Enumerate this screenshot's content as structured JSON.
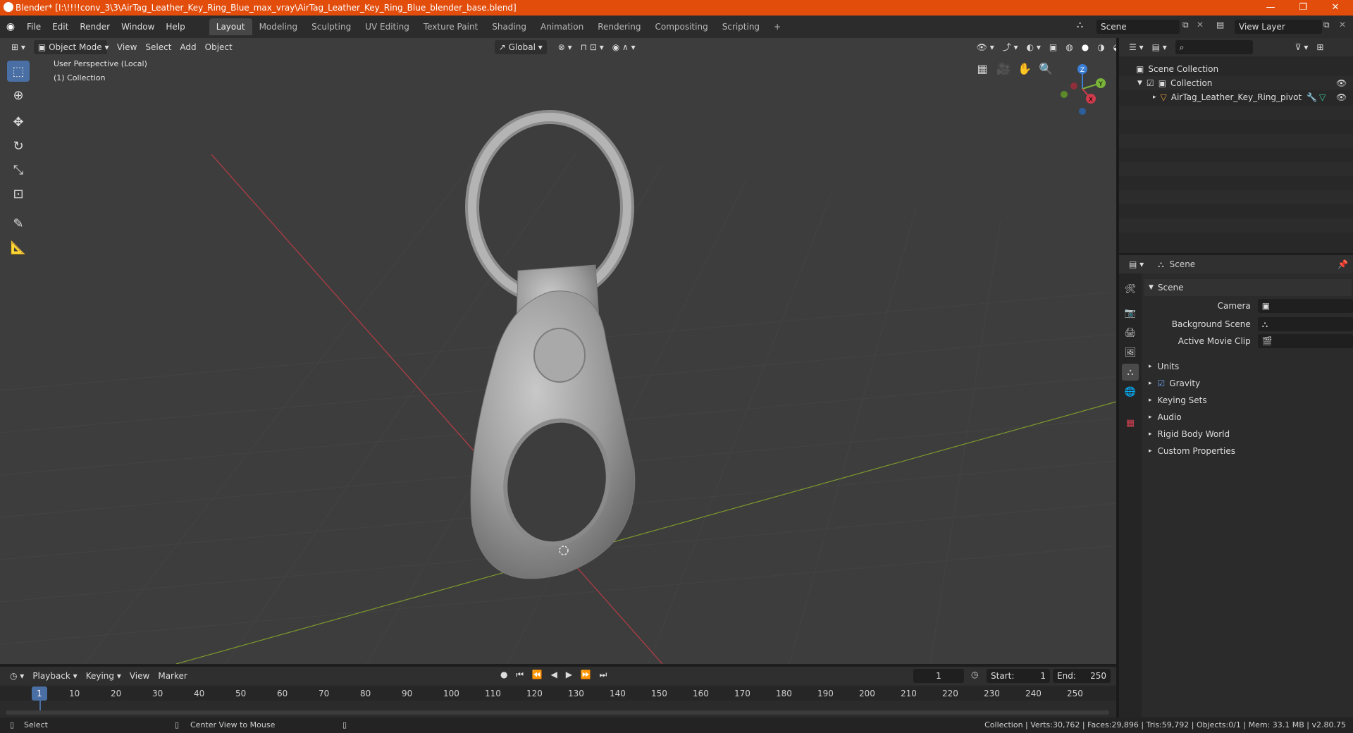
{
  "window": {
    "title": "Blender* [I:\\!!!!conv_3\\3\\AirTag_Leather_Key_Ring_Blue_max_vray\\AirTag_Leather_Key_Ring_Blue_blender_base.blend]",
    "minimize": "—",
    "maximize": "❐",
    "close": "✕"
  },
  "menubar": {
    "items": [
      "File",
      "Edit",
      "Render",
      "Window",
      "Help"
    ]
  },
  "workspaces": {
    "tabs": [
      "Layout",
      "Modeling",
      "Sculpting",
      "UV Editing",
      "Texture Paint",
      "Shading",
      "Animation",
      "Rendering",
      "Compositing",
      "Scripting"
    ],
    "add": "+"
  },
  "scene_selector": {
    "value": "Scene"
  },
  "view_layer": {
    "value": "View Layer"
  },
  "viewport": {
    "mode": "Object Mode",
    "menus": [
      "View",
      "Select",
      "Add",
      "Object"
    ],
    "orientation": "Global",
    "info_line1": "User Perspective (Local)",
    "info_line2": "(1) Collection",
    "gizmo": {
      "z": "Z",
      "y": "Y",
      "x": "X"
    }
  },
  "outliner": {
    "root": "Scene Collection",
    "collection": "Collection",
    "object": "AirTag_Leather_Key_Ring_pivot"
  },
  "properties": {
    "header": "Scene",
    "panel": "Scene",
    "camera_label": "Camera",
    "background_label": "Background Scene",
    "movieclip_label": "Active Movie Clip",
    "sections": [
      "Units",
      "Gravity",
      "Keying Sets",
      "Audio",
      "Rigid Body World",
      "Custom Properties"
    ]
  },
  "timeline": {
    "menus": [
      "Playback",
      "Keying",
      "View",
      "Marker"
    ],
    "current_frame": "1",
    "start_label": "Start:",
    "start_value": "1",
    "end_label": "End:",
    "end_value": "250",
    "ruler": [
      "1",
      "10",
      "20",
      "30",
      "40",
      "50",
      "60",
      "70",
      "80",
      "90",
      "100",
      "110",
      "120",
      "130",
      "140",
      "150",
      "160",
      "170",
      "180",
      "190",
      "200",
      "210",
      "220",
      "230",
      "240",
      "250"
    ]
  },
  "statusbar": {
    "select": "Select",
    "center": "Center View to Mouse",
    "stats": "Collection | Verts:30,762 | Faces:29,896 | Tris:59,792 | Objects:0/1 | Mem: 33.1 MB | v2.80.75"
  },
  "colors": {
    "accent": "#4a6fa5",
    "titlebar": "#e34d0c",
    "x_axis": "#b83d45",
    "y_axis": "#7c9a2c"
  }
}
